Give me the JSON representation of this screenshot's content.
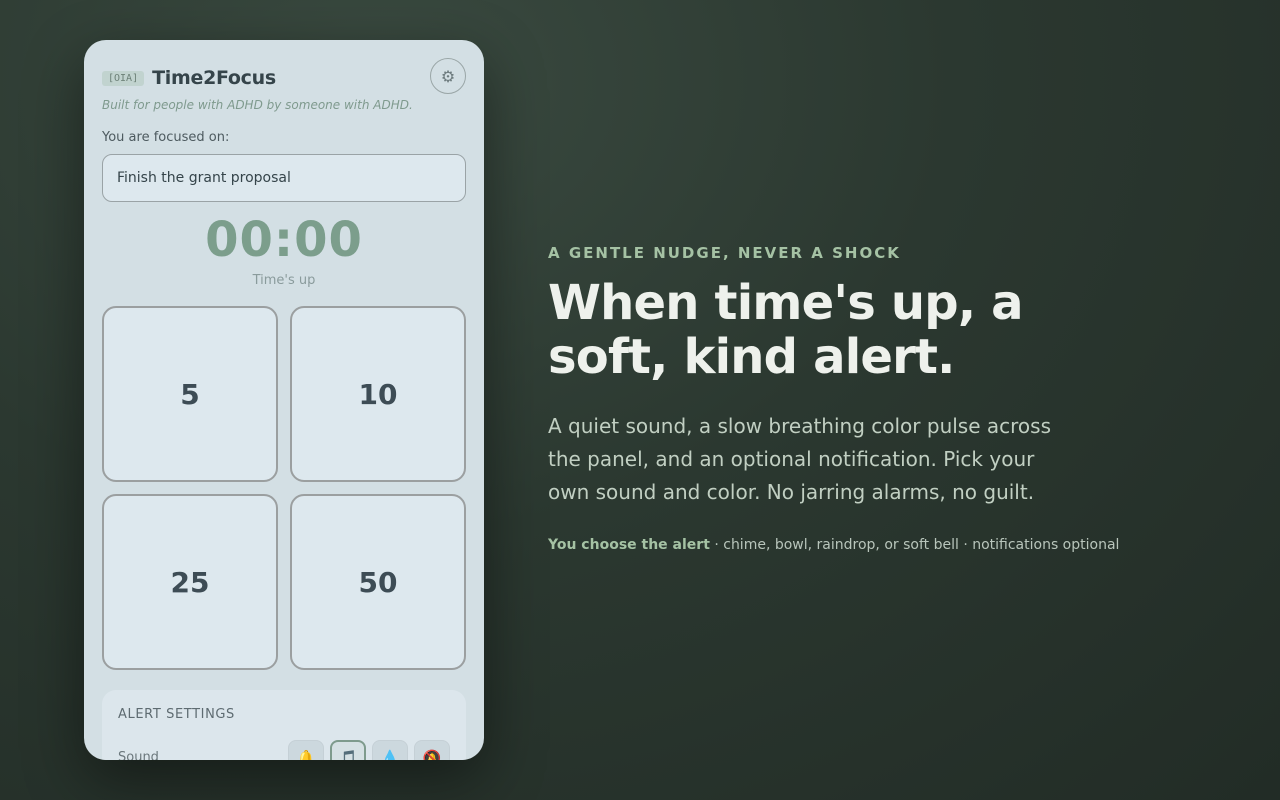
{
  "panel": {
    "brand_tag": "[OIA]",
    "app_title": "Time2Focus",
    "settings_icon": "gear-icon",
    "tagline": "Built for people with ADHD by someone with ADHD.",
    "focus_label": "You are focused on:",
    "focus_value": "Finish the grant proposal",
    "timer": "00:00",
    "timer_status": "Time's up",
    "presets": [
      "5",
      "10",
      "25",
      "50"
    ],
    "alert_settings": {
      "title": "ALERT SETTINGS",
      "sound_label": "Sound",
      "sound_options": [
        {
          "icon": "bell-icon",
          "glyph": "🔔",
          "selected": false
        },
        {
          "icon": "music-note-icon",
          "glyph": "🎵",
          "selected": true
        },
        {
          "icon": "raindrop-icon",
          "glyph": "💧",
          "selected": false
        },
        {
          "icon": "bell-off-icon",
          "glyph": "🔕",
          "selected": false
        }
      ]
    }
  },
  "hero": {
    "eyebrow": "A GENTLE NUDGE, NEVER A SHOCK",
    "headline": "When time's up, a soft, kind alert.",
    "body": "A quiet sound, a slow breathing color pulse across the panel, and an optional notification. Pick your own sound and color. No jarring alarms, no guilt.",
    "footnote_strong": "You choose the alert",
    "footnote_rest": " · chime, bowl, raindrop, or soft bell · notifications optional"
  },
  "colors": {
    "accent": "#7c9e8c",
    "panel_bg": "#d3dfe4",
    "page_bg": "#2b3830",
    "eyebrow": "#a5c2a4"
  }
}
